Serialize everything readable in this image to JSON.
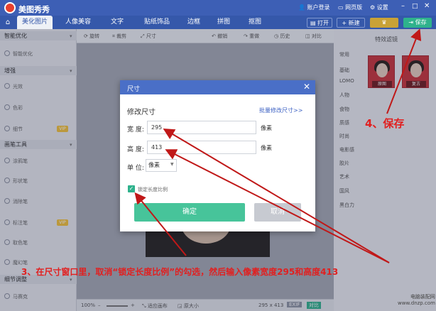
{
  "app": {
    "name": "美图秀秀"
  },
  "titlebar": {
    "account": "账户登录",
    "webpage": "网页版",
    "settings": "设置"
  },
  "nav": {
    "tabs": [
      {
        "label": "美化图片",
        "active": true
      },
      {
        "label": "人像美容"
      },
      {
        "label": "文字"
      },
      {
        "label": "贴纸饰品"
      },
      {
        "label": "边框"
      },
      {
        "label": "拼图"
      },
      {
        "label": "抠图"
      }
    ],
    "open": "打开",
    "new": "新建",
    "save": "保存"
  },
  "sidebar": {
    "sections": [
      {
        "title": "智能优化",
        "items": [
          {
            "label": "智能优化"
          }
        ]
      },
      {
        "title": "增强",
        "items": [
          {
            "label": "光效"
          },
          {
            "label": "色彩"
          },
          {
            "label": "细节",
            "vip": "VIP"
          }
        ]
      },
      {
        "title": "画笔工具",
        "items": [
          {
            "label": "涂鸦笔"
          },
          {
            "label": "形状笔"
          },
          {
            "label": "消除笔"
          },
          {
            "label": "标注笔",
            "vip": "VIP"
          },
          {
            "label": "取色笔"
          },
          {
            "label": "魔幻笔"
          }
        ]
      },
      {
        "title": "细节调整",
        "items": [
          {
            "label": "马赛克"
          }
        ]
      }
    ]
  },
  "toolbar": {
    "rotate": "旋转",
    "crop": "裁剪",
    "size": "尺寸",
    "undo": "撤销",
    "redo": "重做",
    "history": "历史",
    "compare": "对比"
  },
  "rightpanel": {
    "title": "特效滤镜",
    "filters": [
      "常用",
      "基础",
      "LOMO",
      "人物",
      "食物",
      "质感",
      "时尚",
      "电影感",
      "胶片",
      "艺术",
      "国风",
      "黑白力"
    ],
    "thumbs": [
      {
        "label": "原图"
      },
      {
        "label": "复古"
      }
    ]
  },
  "statusbar": {
    "zoom": "100%",
    "fit": "适应画布",
    "original": "原大小",
    "dims": "295 x 413",
    "exif": "EXIF",
    "compare": "对比"
  },
  "dialog": {
    "title": "尺寸",
    "heading": "修改尺寸",
    "batch_link": "批量修改尺寸>>",
    "width_label": "宽 度:",
    "width_value": "295",
    "height_label": "高 度:",
    "height_value": "413",
    "px_unit": "像素",
    "unit_label": "单 位:",
    "unit_value": "像素",
    "lock_checked": true,
    "lock_label": "锁定长度比例",
    "ok": "确定",
    "cancel": "取消"
  },
  "annotations": {
    "step3": "3、在尺寸窗口里，取消“锁定长度比例”的勾选，然后输入像素宽度295和高度413",
    "step4": "4、保存"
  },
  "watermark": {
    "line1": "电脑装配网",
    "line2": "www.dnzp.com"
  },
  "colors": {
    "titlebar": "#3d5fb5",
    "accent_green": "#47c49a",
    "annotation_red": "#e12020",
    "save_green": "#2eb28c"
  }
}
